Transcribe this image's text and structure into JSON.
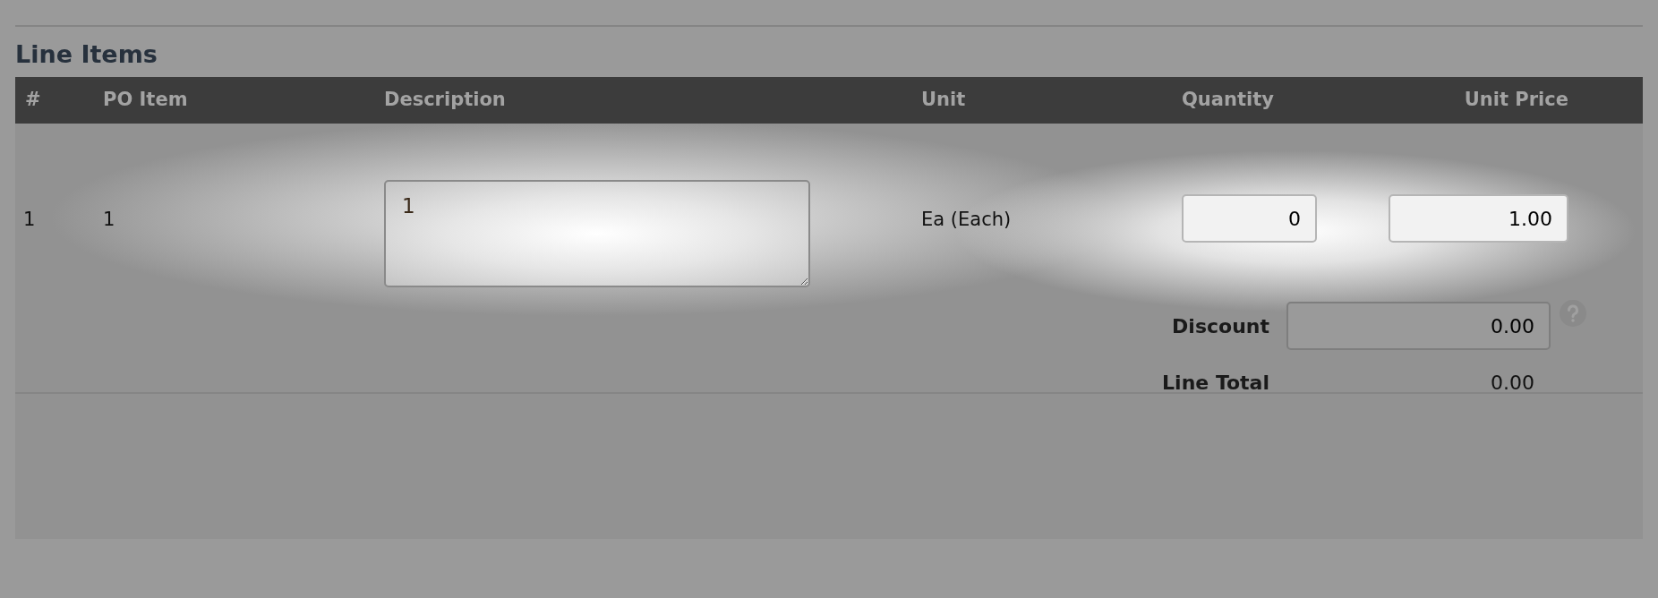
{
  "section_title": "Line Items",
  "columns": [
    "#",
    "PO Item",
    "Description",
    "Unit",
    "Quantity",
    "Unit Price"
  ],
  "rows": [
    {
      "number": "1",
      "po_item": "1",
      "description": "1",
      "unit": "Ea (Each)",
      "quantity": "0",
      "unit_price": "1.00",
      "discount_label": "Discount",
      "discount": "0.00",
      "line_total_label": "Line Total",
      "line_total": "0.00"
    }
  ]
}
